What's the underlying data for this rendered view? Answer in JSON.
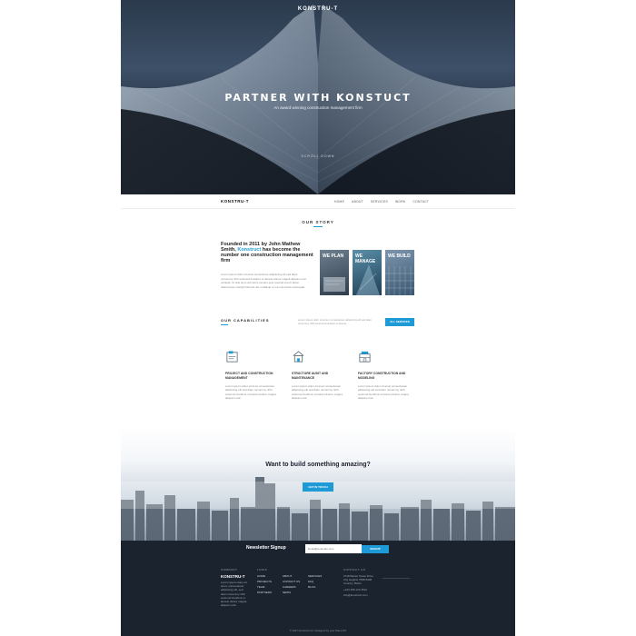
{
  "hero": {
    "logo": "KONSTRU-T",
    "title": "PARTNER WITH KONSTUCT",
    "subtitle": "An award winning construction management firm",
    "scroll": "SCROLL DOWN"
  },
  "nav": {
    "brand": "KONSTRU-T",
    "links": [
      "HOME",
      "ABOUT",
      "SERVICES",
      "WORK",
      "CONTACT"
    ]
  },
  "story": {
    "section_title": "OUR STORY",
    "heading_part1": "Founded in 2011 by John Mathew Smith, ",
    "heading_accent": "Konstruct",
    "heading_part2": " has become the number one construction management firm",
    "paragraph": "Lorem ipsum dolor sit amet consectetur adipiscing elit sed diam nonummy nibh euismod tincidunt ut laoreet dolore magna aliquam erat volutpat. Ut wisi enim ad minim veniam quis nostrud exerci tation ullamcorper suscipit lobortis nisl ut aliquip ex ea commodo consequat.",
    "tiles": [
      {
        "label": "WE PLAN"
      },
      {
        "label": "WE MANAGE"
      },
      {
        "label": "WE BUILD"
      }
    ]
  },
  "capabilities": {
    "title": "OUR CAPABILITIES",
    "text": "Lorem ipsum dolor sit amet, consectetuer adipiscing elit sed diam nonummy nibh euismod tincidunt ut laoreet.",
    "button": "ALL SERVICES",
    "cards": [
      {
        "icon": "blueprint-icon",
        "title": "PROJECT AND CONSTRUCTION MANAGEMENT",
        "desc": "Lorem ipsum dolor sit amet consectetuer adipiscing elit sed diam nonummy nibh euismod tincidunt ut laoreet dolore magna aliquam erat."
      },
      {
        "icon": "building-icon",
        "title": "STRUCTURE AUDIT AND MAINTENANCE",
        "desc": "Lorem ipsum dolor sit amet consectetuer adipiscing elit sed diam nonummy nibh euismod tincidunt ut laoreet dolore magna aliquam erat."
      },
      {
        "icon": "factory-icon",
        "title": "FACTORY CONSTRUCTION AND MODELING",
        "desc": "Lorem ipsum dolor sit amet consectetuer adipiscing elit sed diam nonummy nibh euismod tincidunt ut laoreet dolore magna aliquam erat."
      }
    ]
  },
  "cta": {
    "heading": "Want to build something amazing?",
    "button": "GET IN TOUCH"
  },
  "footer": {
    "newsletter_label": "Newsletter Signup",
    "email_placeholder": "Email@example.com",
    "signup_button": "SIGNUP",
    "company_head": "COMPANY",
    "company_logo": "KONSTRU-T",
    "company_text": "Lorem ipsum dolor sit amet, consectetuer adipiscing elit, sed diam nonummy nibh euismod tincidunt ut laoreet dolore magna aliquam erat.",
    "links_head": "LINKS",
    "links_col1": [
      "HOME",
      "PROJECTS",
      "TEAM",
      "PARTNERS"
    ],
    "links_col2": [
      "ABOUT",
      "CONTACT US",
      "CAREERS",
      "NEWS"
    ],
    "links_col3": [
      "SERVICES",
      "FAQ",
      "BLOG"
    ],
    "contact_head": "CONTACT US",
    "contact_address": "3718 Baxter Street Drive City Heights 7658 5090 Country, Berlin",
    "contact_phone": "+123 456 123 4512",
    "contact_email": "info@konstruct.com",
    "copyright": "© 2017 Konstruct Inc. Designed by your Name Plz"
  },
  "colors": {
    "accent": "#1e9ad6",
    "footer_bg": "#1b232e"
  }
}
